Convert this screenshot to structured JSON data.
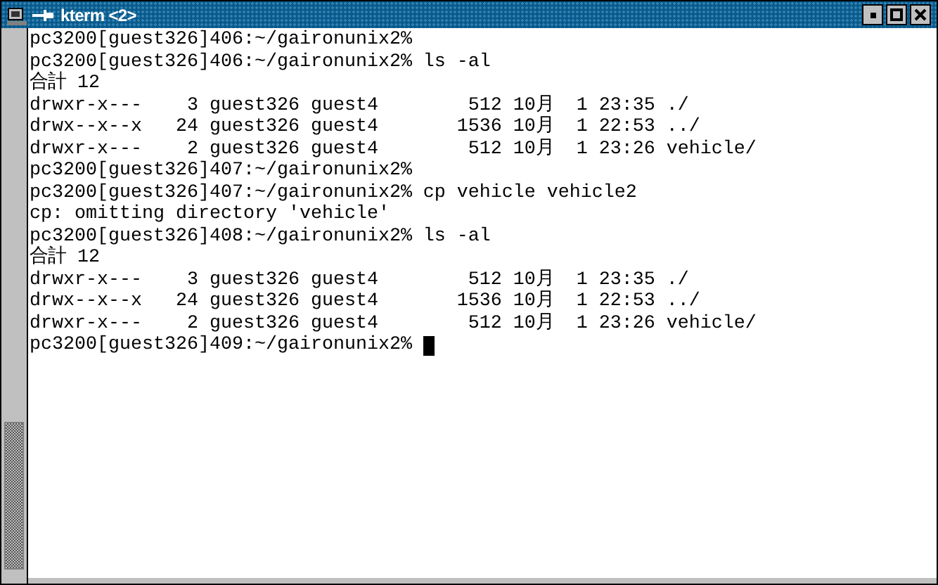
{
  "window": {
    "title": "kterm <2>"
  },
  "terminal": {
    "lines": [
      "pc3200[guest326]406:~/gaironunix2%",
      "pc3200[guest326]406:~/gaironunix2% ls -al",
      "合計 12",
      "drwxr-x---    3 guest326 guest4        512 10月  1 23:35 ./",
      "drwx--x--x   24 guest326 guest4       1536 10月  1 22:53 ../",
      "drwxr-x---    2 guest326 guest4        512 10月  1 23:26 vehicle/",
      "pc3200[guest326]407:~/gaironunix2%",
      "pc3200[guest326]407:~/gaironunix2% cp vehicle vehicle2",
      "cp: omitting directory 'vehicle'",
      "pc3200[guest326]408:~/gaironunix2% ls -al",
      "合計 12",
      "drwxr-x---    3 guest326 guest4        512 10月  1 23:35 ./",
      "drwx--x--x   24 guest326 guest4       1536 10月  1 22:53 ../",
      "drwxr-x---    2 guest326 guest4        512 10月  1 23:26 vehicle/",
      "pc3200[guest326]409:~/gaironunix2%"
    ],
    "cursor": true
  }
}
